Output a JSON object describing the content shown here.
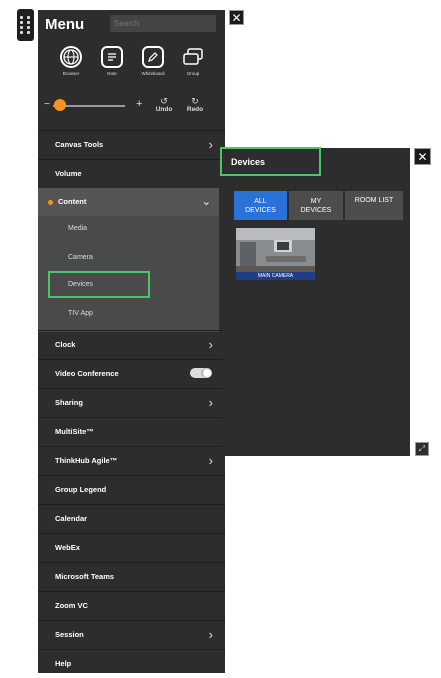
{
  "menu": {
    "title": "Menu",
    "search_placeholder": "Search",
    "close_glyph": "✕",
    "tools": [
      {
        "label": "Browser",
        "icon": "globe-icon"
      },
      {
        "label": "Note",
        "icon": "note-icon"
      },
      {
        "label": "Whiteboard",
        "icon": "whiteboard-icon"
      },
      {
        "label": "Group",
        "icon": "group-icon"
      }
    ],
    "slider": {
      "minus": "−",
      "plus": "+",
      "level": 0.1
    },
    "undo_label": "Undo",
    "redo_label": "Redo",
    "items": [
      {
        "label": "Canvas Tools",
        "chevron": "›"
      },
      {
        "label": "Volume",
        "chevron": ""
      }
    ],
    "content": {
      "label": "Content",
      "chevron": "⌄",
      "sub_items": [
        "Media",
        "Camera",
        "Devices",
        "TIV App"
      ]
    },
    "items_after": [
      {
        "label": "Clock",
        "chevron": "›"
      },
      {
        "label": "Video Conference",
        "chevron": "",
        "toggle": true
      },
      {
        "label": "Sharing",
        "chevron": "›"
      },
      {
        "label": "MultiSite™",
        "chevron": ""
      },
      {
        "label": "ThinkHub Agile™",
        "chevron": "›"
      },
      {
        "label": "Group Legend",
        "chevron": ""
      },
      {
        "label": "Calendar",
        "chevron": ""
      },
      {
        "label": "WebEx",
        "chevron": ""
      },
      {
        "label": "Microsoft Teams",
        "chevron": ""
      },
      {
        "label": "Zoom VC",
        "chevron": ""
      },
      {
        "label": "Session",
        "chevron": "›"
      },
      {
        "label": "Help",
        "chevron": ""
      }
    ]
  },
  "devices_panel": {
    "title": "Devices",
    "close_glyph": "✕",
    "tabs": [
      {
        "line1": "ALL",
        "line2": "DEVICES",
        "active": true
      },
      {
        "line1": "MY",
        "line2": "DEVICES",
        "active": false
      },
      {
        "line1": "ROOM LIST",
        "line2": "",
        "active": false
      }
    ],
    "thumbnail_caption": "MAIN CAMERA",
    "corner_glyph": "⤢"
  },
  "colors": {
    "panel_bg": "#2d2d2d",
    "accent_orange": "#f7941d",
    "highlight_green": "#4cc46a",
    "active_tab_blue": "#2b72d8",
    "caption_blue": "#1f3e87"
  }
}
